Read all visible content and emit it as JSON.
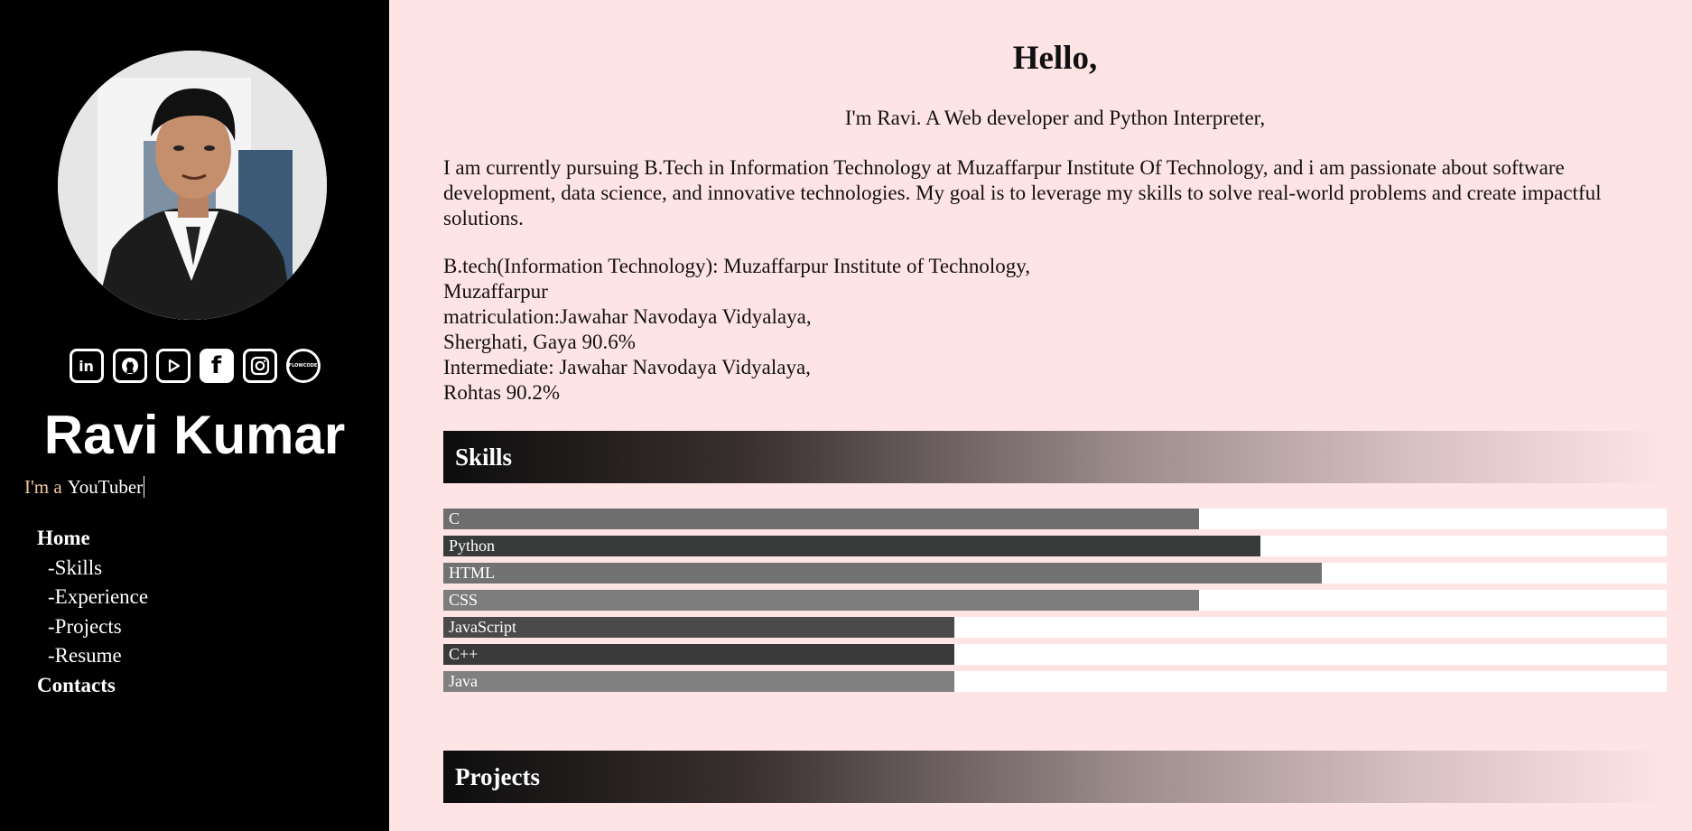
{
  "sidebar": {
    "name": "Ravi Kumar",
    "typing_prefix": "I'm a",
    "typing_word": "YouTuber",
    "socials": [
      {
        "icon": "linkedin-icon",
        "glyph": "in"
      },
      {
        "icon": "github-icon",
        "glyph": ""
      },
      {
        "icon": "youtube-icon",
        "glyph": ""
      },
      {
        "icon": "facebook-icon",
        "glyph": "f"
      },
      {
        "icon": "instagram-icon",
        "glyph": ""
      },
      {
        "icon": "flowcode-icon",
        "glyph": "FLOWCODE"
      }
    ],
    "nav": {
      "home": "Home",
      "skills": "-Skills",
      "experience": "-Experience",
      "projects": "-Projects",
      "resume": "-Resume",
      "contacts": "Contacts"
    }
  },
  "main": {
    "hello": "Hello,",
    "intro": "I'm Ravi. A Web developer and Python Interpreter,",
    "about": "I am currently pursuing B.Tech in Information Technology at Muzaffarpur Institute Of Technology, and i am passionate about software development, data science, and innovative technologies. My goal is to leverage my skills to solve real-world problems and create impactful solutions.",
    "education": [
      "B.tech(Information Technology): Muzaffarpur Institute of Technology,",
      "Muzaffarpur",
      "matriculation:Jawahar Navodaya Vidyalaya,",
      "Sherghati, Gaya 90.6%",
      "Intermediate: Jawahar Navodaya Vidyalaya,",
      "Rohtas 90.2%"
    ],
    "skills_title": "Skills",
    "projects_title": "Projects",
    "skills": [
      {
        "label": "C",
        "level": 0.618,
        "color": "#6e6e6e"
      },
      {
        "label": "Python",
        "level": 0.668,
        "color": "#393b3b"
      },
      {
        "label": "HTML",
        "level": 0.718,
        "color": "#727272"
      },
      {
        "label": "CSS",
        "level": 0.618,
        "color": "#7d7d7d"
      },
      {
        "label": "JavaScript",
        "level": 0.418,
        "color": "#4a4a4a"
      },
      {
        "label": "C++",
        "level": 0.418,
        "color": "#3a3a3a"
      },
      {
        "label": "Java",
        "level": 0.418,
        "color": "#808080"
      }
    ]
  }
}
